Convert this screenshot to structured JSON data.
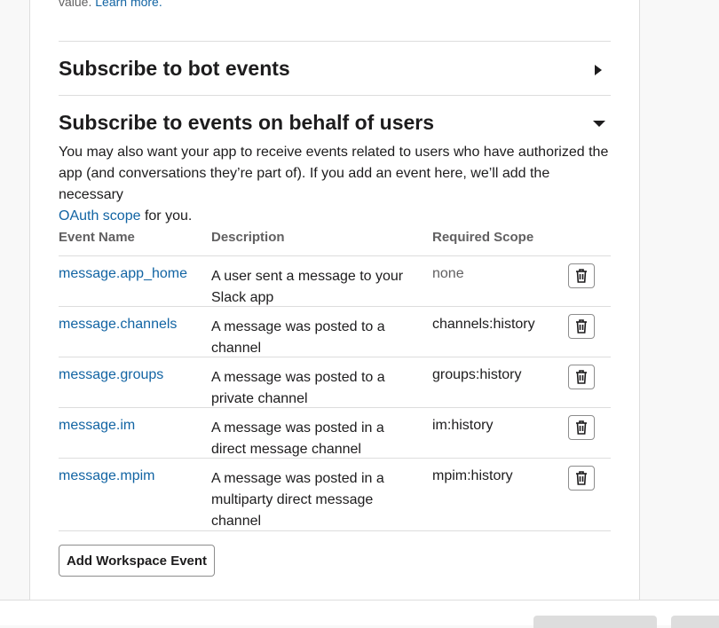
{
  "top": {
    "text": "value.",
    "link": "Learn more."
  },
  "bot_section": {
    "title": "Subscribe to bot events"
  },
  "user_section": {
    "title": "Subscribe to events on behalf of users",
    "description": "You may also want your app to receive events related to users who have authorized the app (and conversations they’re part of). If you add an event here, we’ll add the necessary",
    "link": "OAuth scope",
    "description_end": "for you."
  },
  "table": {
    "headers": {
      "name": "Event Name",
      "description": "Description",
      "scope": "Required Scope"
    },
    "rows": [
      {
        "name": "message.app_home",
        "description": "A user sent a message to your Slack app",
        "scope": "none"
      },
      {
        "name": "message.channels",
        "description": "A message was posted to a channel",
        "scope": "channels:history"
      },
      {
        "name": "message.groups",
        "description": "A message was posted to a private channel",
        "scope": "groups:history"
      },
      {
        "name": "message.im",
        "description": "A message was posted in a direct message channel",
        "scope": "im:history"
      },
      {
        "name": "message.mpim",
        "description": "A message was posted in a multiparty direct message channel",
        "scope": "mpim:history"
      }
    ]
  },
  "add_button": {
    "label": "Add Workspace Event"
  },
  "icons": {
    "bot_toggle": "triangle-right-icon",
    "user_toggle": "triangle-down-icon",
    "delete": "trash-icon"
  },
  "colors": {
    "link": "#1264a3",
    "text": "#1d1c1d",
    "muted": "#616061",
    "border": "#dddddd"
  }
}
